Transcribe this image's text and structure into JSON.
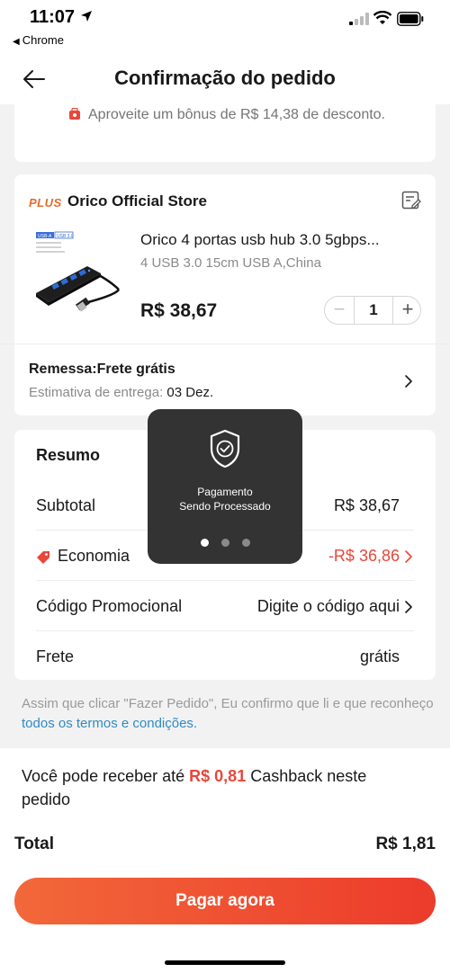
{
  "status_bar": {
    "time": "11:07",
    "back_app": "Chrome"
  },
  "header": {
    "title": "Confirmação do pedido"
  },
  "bonus": {
    "text": "Aproveite um bônus de R$ 14,38 de desconto."
  },
  "store": {
    "badge": "PLUS",
    "name": "Orico Official Store"
  },
  "product": {
    "title": "Orico 4 portas usb hub 3.0 5gbps...",
    "variant": "4 USB 3.0 15cm USB A,China",
    "price": "R$ 38,67",
    "quantity": "1",
    "image_labels": {
      "tag1": "USB-A",
      "tag2": "USB 3.0"
    }
  },
  "shipping": {
    "title": "Remessa:Frete grátis",
    "estimate_label": "Estimativa de entrega:",
    "estimate_date": "03 Dez."
  },
  "summary": {
    "title": "Resumo",
    "subtotal_label": "Subtotal",
    "subtotal_value": "R$ 38,67",
    "economy_label": "Economia",
    "economy_value": "-R$ 36,86",
    "promo_label": "Código Promocional",
    "promo_value": "Digite o código aqui",
    "shipping_label": "Frete",
    "shipping_value": "grátis"
  },
  "terms": {
    "text": "Assim que clicar \"Fazer Pedido\", Eu confirmo que li e que reconheço",
    "link": "todos os termos e condições."
  },
  "cashback": {
    "prefix": "Você pode receber até",
    "amount": "R$ 0,81",
    "suffix": "Cashback neste pedido"
  },
  "total": {
    "label": "Total",
    "value": "R$ 1,81"
  },
  "pay_button": {
    "label": "Pagar agora"
  },
  "processing": {
    "line1": "Pagamento",
    "line2": "Sendo Processado"
  },
  "colors": {
    "accent_red": "#e8473a",
    "button_gradient_start": "#f2683a",
    "button_gradient_end": "#ec3b2b",
    "link_blue": "#2e8cc4"
  }
}
